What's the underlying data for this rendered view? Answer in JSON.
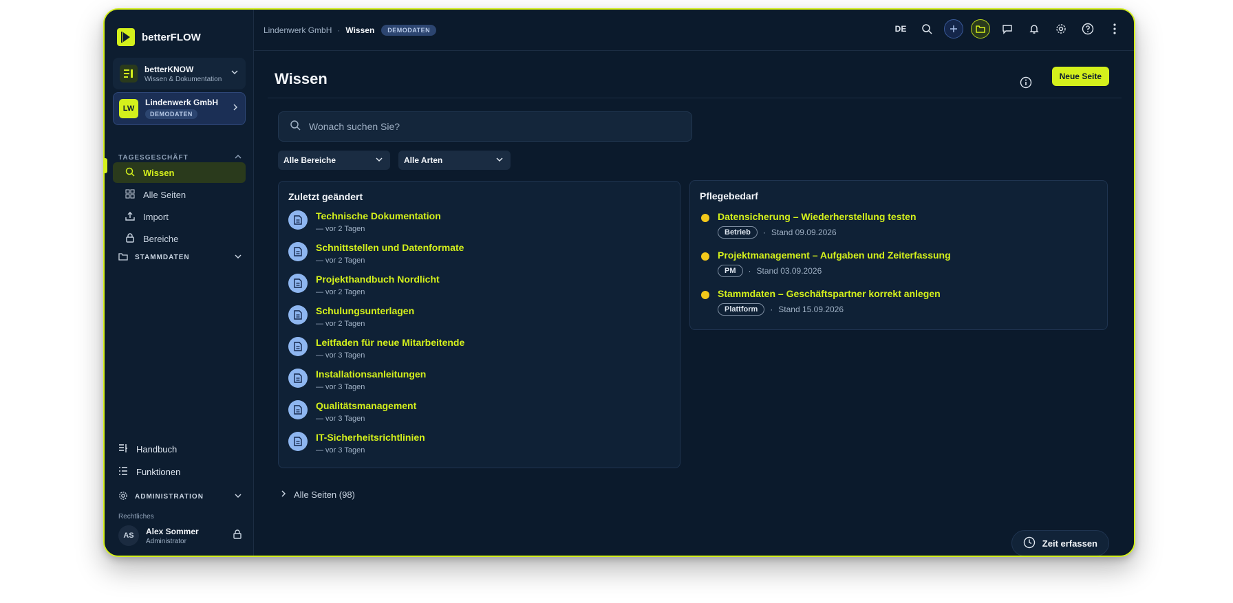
{
  "sidebar": {
    "brand": "betterFLOW",
    "app": {
      "title": "betterKNOW",
      "subtitle": "Wissen & Dokumentation"
    },
    "org": {
      "initials": "LW",
      "name": "Lindenwerk GmbH",
      "badge": "DEMODATEN"
    },
    "section_daily": "TAGESGESCHÄFT",
    "nav": [
      {
        "label": "Wissen",
        "icon": "search-icon",
        "active": true
      },
      {
        "label": "Alle Seiten",
        "icon": "grid-icon"
      },
      {
        "label": "Import",
        "icon": "upload-icon"
      },
      {
        "label": "Bereiche",
        "icon": "lock-icon"
      }
    ],
    "section_master": "STAMMDATEN",
    "bottom": [
      {
        "label": "Handbuch",
        "icon": "book-icon"
      },
      {
        "label": "Funktionen",
        "icon": "list-icon"
      }
    ],
    "section_admin": "ADMINISTRATION",
    "legal": "Rechtliches",
    "user": {
      "initials": "AS",
      "name": "Alex Sommer",
      "role": "Administrator"
    }
  },
  "topbar": {
    "breadcrumb_org": "Lindenwerk GmbH",
    "breadcrumb_sep": "·",
    "breadcrumb_current": "Wissen",
    "badge": "DEMODATEN",
    "lang": "DE"
  },
  "page": {
    "title": "Wissen",
    "new_button": "Neue Seite",
    "search_placeholder": "Wonach suchen Sie?",
    "filter_areas": "Alle Bereiche",
    "filter_types": "Alle Arten",
    "all_pages": "Alle Seiten (98)",
    "time_button": "Zeit erfassen"
  },
  "recent": {
    "title": "Zuletzt geändert",
    "items": [
      {
        "title": "Technische Dokumentation",
        "meta": "—  vor 2 Tagen"
      },
      {
        "title": "Schnittstellen und Datenformate",
        "meta": "—  vor 2 Tagen"
      },
      {
        "title": "Projekthandbuch Nordlicht",
        "meta": "—  vor 2 Tagen"
      },
      {
        "title": "Schulungsunterlagen",
        "meta": "—  vor 2 Tagen"
      },
      {
        "title": "Leitfaden für neue Mitarbeitende",
        "meta": "—  vor 3 Tagen"
      },
      {
        "title": "Installationsanleitungen",
        "meta": "—  vor 3 Tagen"
      },
      {
        "title": "Qualitätsmanagement",
        "meta": "—  vor 3 Tagen"
      },
      {
        "title": "IT-Sicherheitsrichtlinien",
        "meta": "—  vor 3 Tagen"
      }
    ]
  },
  "care": {
    "title": "Pflegebedarf",
    "items": [
      {
        "title": "Datensicherung – Wiederherstellung testen",
        "tag": "Betrieb",
        "stand": "Stand 09.09.2026"
      },
      {
        "title": "Projektmanagement – Aufgaben und Zeiterfassung",
        "tag": "PM",
        "stand": "Stand 03.09.2026"
      },
      {
        "title": "Stammdaten – Geschäftspartner korrekt anlegen",
        "tag": "Plattform",
        "stand": "Stand 15.09.2026"
      }
    ]
  },
  "colors": {
    "accent": "#d4f01c",
    "background": "#0b1a2c",
    "sidebar": "#0d1d30",
    "warning_dot": "#f3c81a",
    "doc_icon": "#8eb6f0"
  }
}
